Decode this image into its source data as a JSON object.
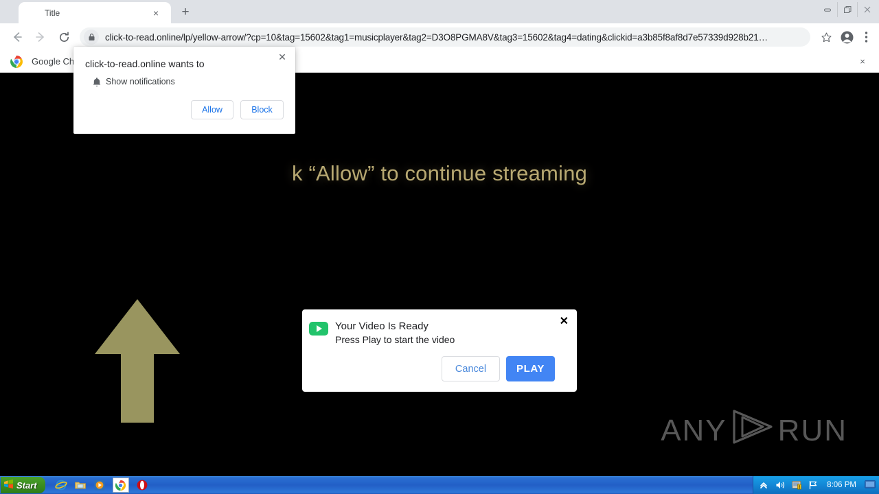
{
  "window": {
    "controls": {
      "minimize": "minimize-button",
      "restore": "restore-button",
      "close": "close-button"
    }
  },
  "tabstrip": {
    "tab_title": "Title",
    "tab_close_label": "×",
    "new_tab_label": "+"
  },
  "toolbar": {
    "back_label": "←",
    "forward_label": "→",
    "reload_label": "↻",
    "url_host": "click-to-read.online",
    "url_path": "/lp/yellow-arrow/?cp=10&tag=15602&tag1=musicplayer&tag2=D3O8PGMA8V&tag3=15602&tag4=dating&clickid=a3b85f8af8d7e57339d928b21…",
    "url_full": "click-to-read.online/lp/yellow-arrow/?cp=10&tag=15602&tag1=musicplayer&tag2=D3O8PGMA8V&tag3=15602&tag4=dating&clickid=a3b85f8af8d7e57339d928b21…",
    "lock_icon": "lock-icon",
    "bookmark_icon": "star-icon",
    "profile_icon": "profile-avatar-icon",
    "menu_icon": "three-dot-menu-icon"
  },
  "infobar": {
    "logo": "chrome-logo-icon",
    "text": "Google Ch",
    "close_label": "×"
  },
  "page": {
    "headline": "k “Allow” to continue streaming",
    "arrow_icon": "up-arrow-icon",
    "arrow_color": "#99955f",
    "headline_color": "#b8a972",
    "background_color": "#000000",
    "watermark": {
      "left": "ANY",
      "right": "RUN",
      "logo": "anyrun-play-logo"
    }
  },
  "video_modal": {
    "icon": "video-play-icon",
    "icon_color": "#22c36b",
    "title": "Your Video Is Ready",
    "subtitle": "Press Play to start the video",
    "close_label": "✕",
    "cancel_label": "Cancel",
    "play_label": "PLAY",
    "play_color": "#4285f4"
  },
  "permission_bubble": {
    "title": "click-to-read.online wants to",
    "permission_icon": "bell-icon",
    "permission_label": "Show notifications",
    "allow_label": "Allow",
    "block_label": "Block",
    "close_label": "✕"
  },
  "taskbar": {
    "start_label": "Start",
    "quicklaunch": [
      {
        "name": "internet-explorer-icon"
      },
      {
        "name": "file-explorer-icon"
      },
      {
        "name": "media-player-icon"
      },
      {
        "name": "chrome-taskbar-icon"
      },
      {
        "name": "opera-icon"
      }
    ],
    "tray": [
      {
        "name": "show-hidden-icons"
      },
      {
        "name": "volume-icon"
      },
      {
        "name": "security-alert-icon"
      },
      {
        "name": "network-flag-icon"
      }
    ],
    "clock": "8:06 PM",
    "show_desktop": "show-desktop-icon"
  }
}
